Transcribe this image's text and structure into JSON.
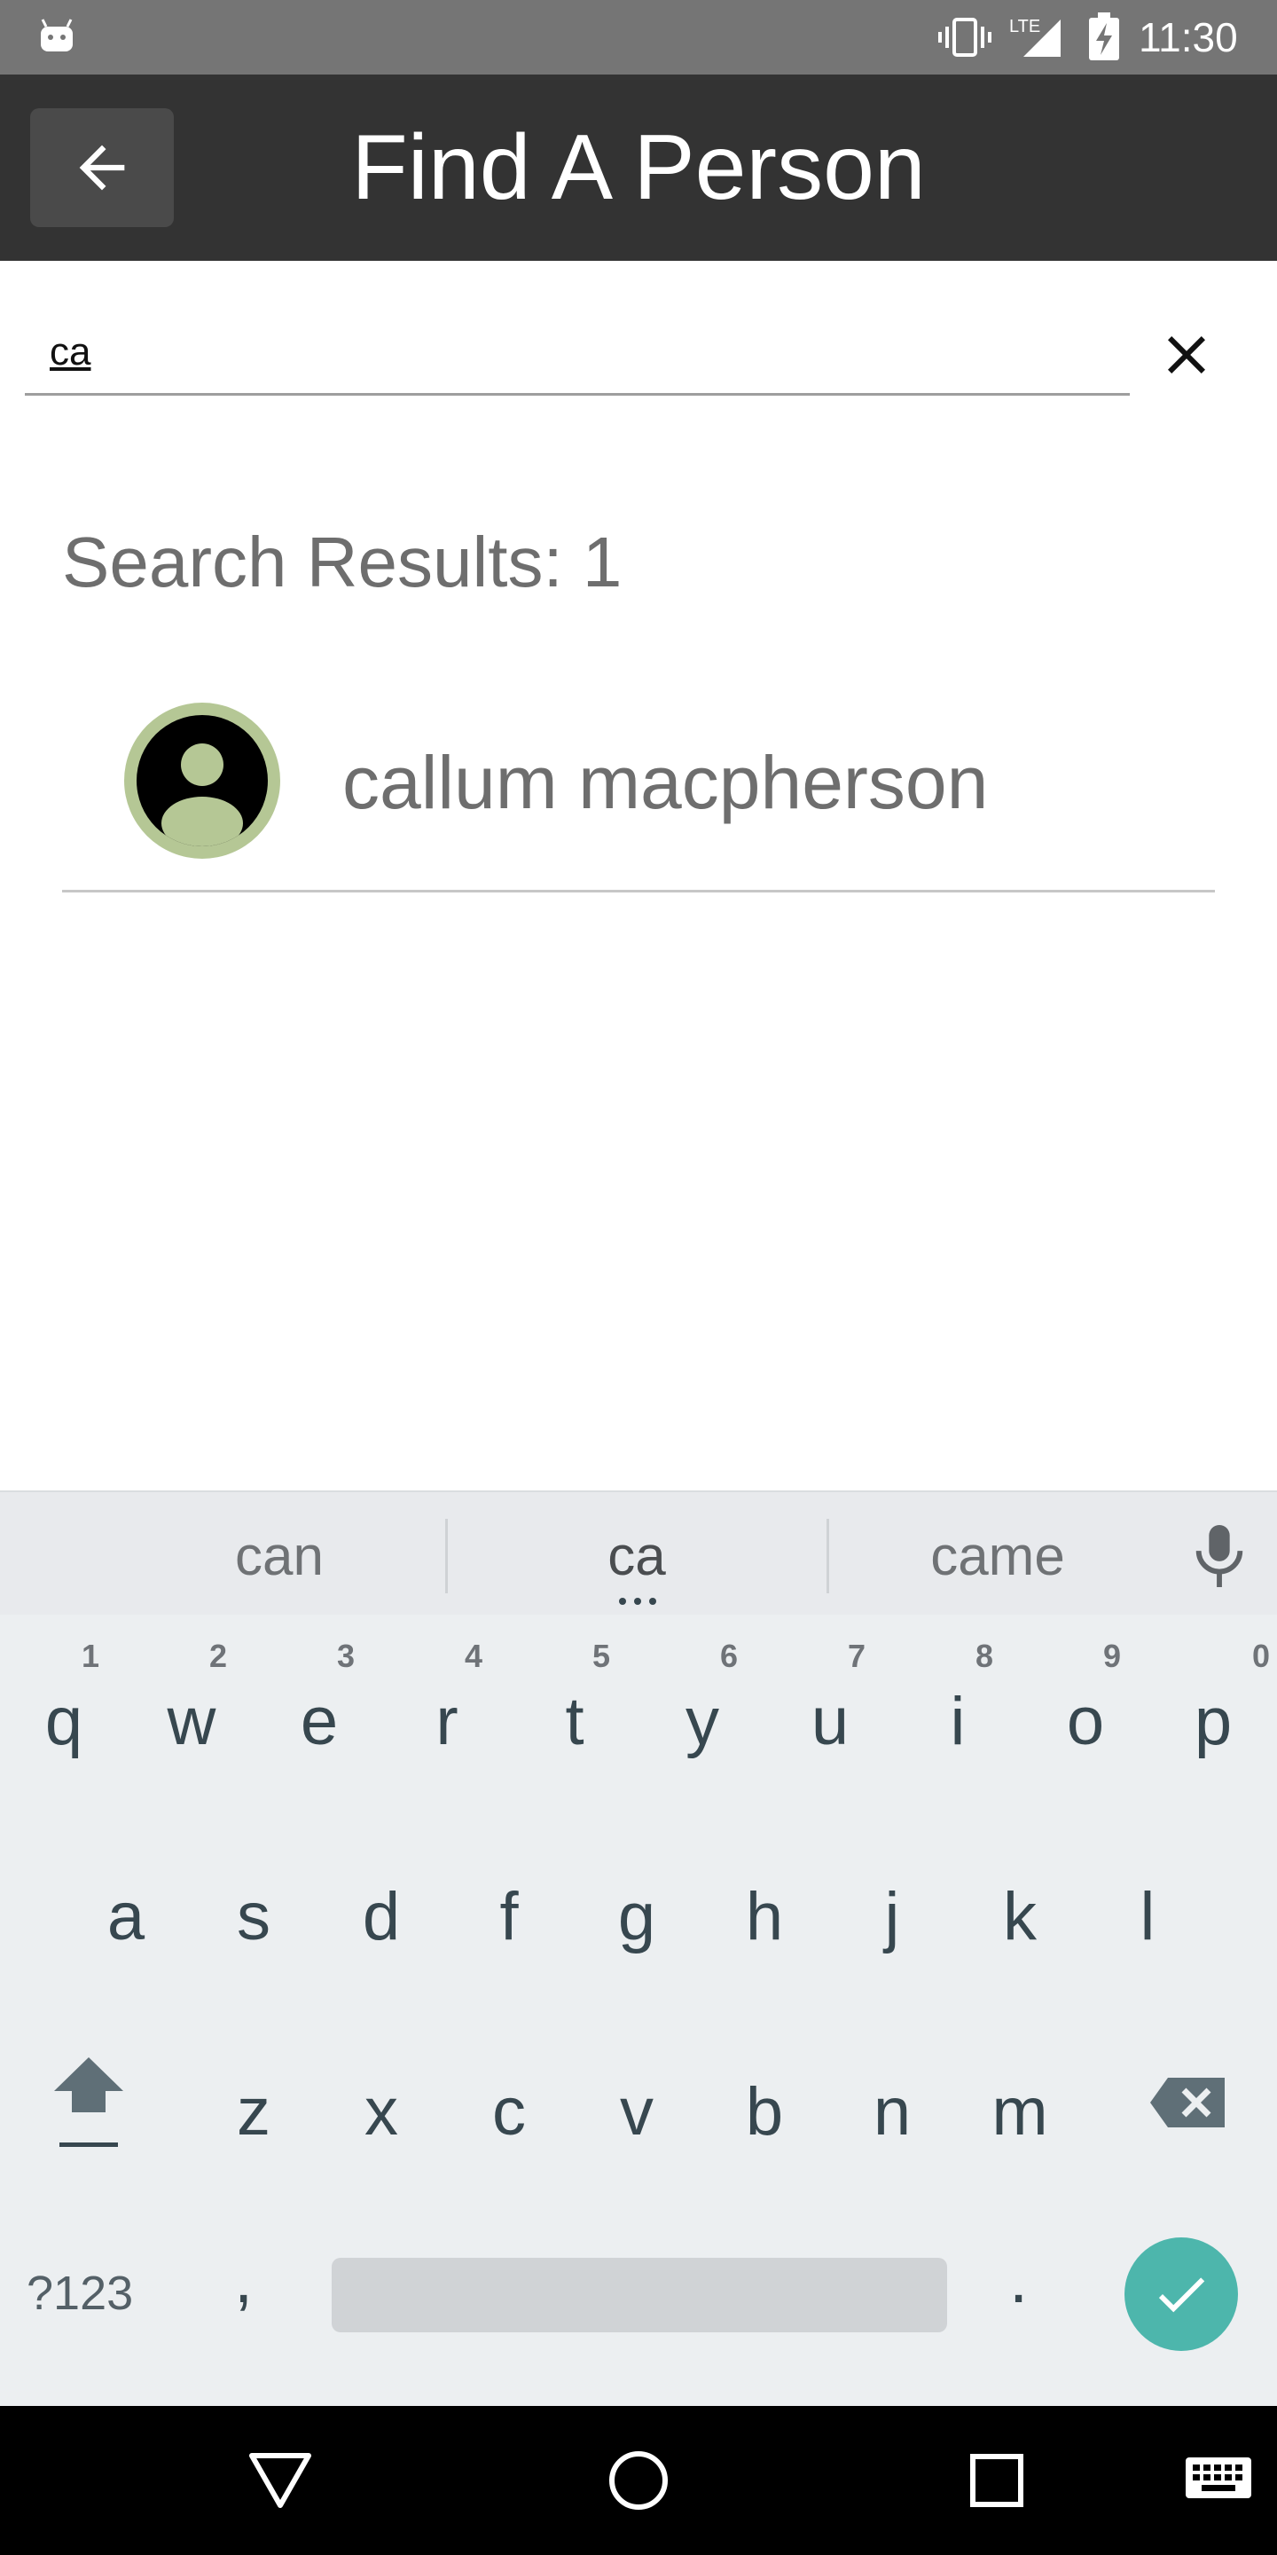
{
  "status_bar": {
    "time": "11:30",
    "network": "LTE",
    "icons": [
      "android-icon",
      "vibrate-icon",
      "lte-signal-icon",
      "battery-charging-icon"
    ]
  },
  "app_bar": {
    "title": "Find A Person",
    "back_icon": "arrow-left-icon"
  },
  "search": {
    "value": "ca",
    "clear_icon": "close-icon"
  },
  "results": {
    "label": "Search Results: 1",
    "items": [
      {
        "name": "callum macpherson",
        "avatar_icon": "person-icon"
      }
    ]
  },
  "keyboard": {
    "suggestions": [
      "can",
      "ca",
      "came"
    ],
    "mic_icon": "mic-icon",
    "row1": [
      {
        "key": "q",
        "hint": "1"
      },
      {
        "key": "w",
        "hint": "2"
      },
      {
        "key": "e",
        "hint": "3"
      },
      {
        "key": "r",
        "hint": "4"
      },
      {
        "key": "t",
        "hint": "5"
      },
      {
        "key": "y",
        "hint": "6"
      },
      {
        "key": "u",
        "hint": "7"
      },
      {
        "key": "i",
        "hint": "8"
      },
      {
        "key": "o",
        "hint": "9"
      },
      {
        "key": "p",
        "hint": "0"
      }
    ],
    "row2": [
      "a",
      "s",
      "d",
      "f",
      "g",
      "h",
      "j",
      "k",
      "l"
    ],
    "row3": [
      "z",
      "x",
      "c",
      "v",
      "b",
      "n",
      "m"
    ],
    "symbols_label": "?123",
    "comma": ",",
    "period": "."
  },
  "colors": {
    "status_bar": "#757575",
    "app_bar": "#333333",
    "avatar_ring": "#b5c795",
    "enter_key": "#4db6ac",
    "keyboard_bg": "#eceff1"
  }
}
